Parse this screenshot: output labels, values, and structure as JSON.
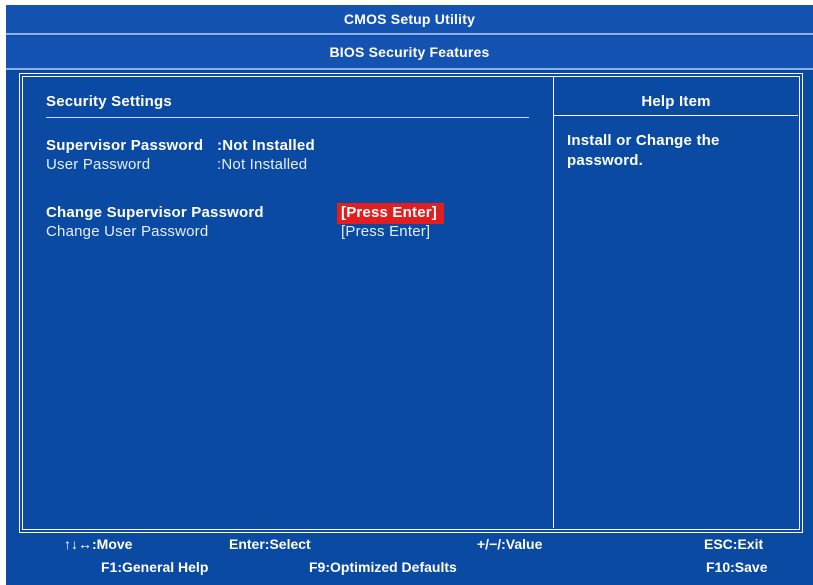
{
  "header": {
    "title": "CMOS Setup Utility",
    "subtitle": "BIOS Security Features"
  },
  "left_panel": {
    "section_title": "Security Settings",
    "rows": [
      {
        "label": "Supervisor Password",
        "value": ":Not Installed"
      },
      {
        "label": "User Password",
        "value": ":Not Installed"
      }
    ],
    "items": [
      {
        "label": "Change Supervisor Password",
        "value": "[Press Enter]",
        "selected": true
      },
      {
        "label": "Change User Password",
        "value": "[Press Enter]",
        "selected": false
      }
    ]
  },
  "help_panel": {
    "title": "Help Item",
    "text_line1": "Install or Change the",
    "text_line2": "password."
  },
  "footer": {
    "move": ":Move",
    "arrows": "↑↓↔",
    "select": "Enter:Select",
    "value": "+/−/:Value",
    "exit": "ESC:Exit",
    "general_help": "F1:General Help",
    "optimized": "F9:Optimized Defaults",
    "save": "F10:Save"
  },
  "colors": {
    "background": "#0b4aa3",
    "title_bar": "#1553b3",
    "highlight": "#e02020",
    "text": "#ffffff"
  }
}
